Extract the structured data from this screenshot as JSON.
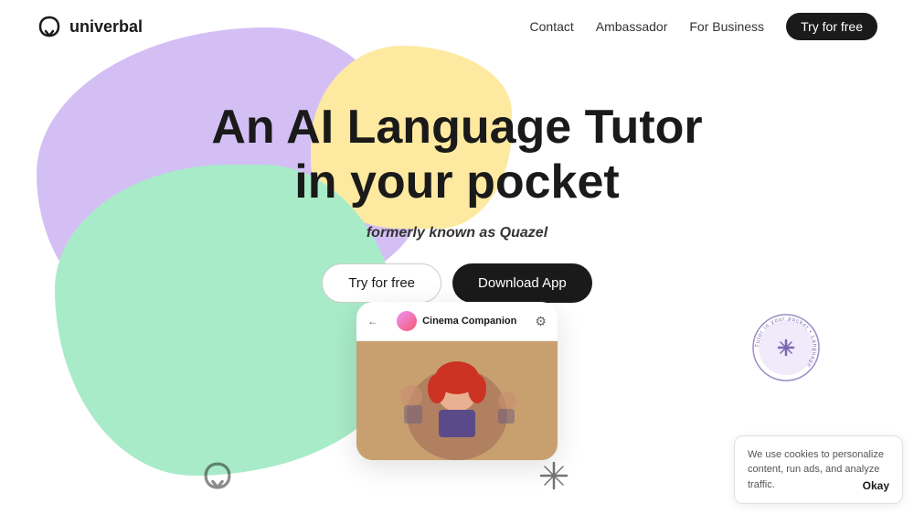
{
  "nav": {
    "logo_text": "univerbal",
    "links": [
      {
        "label": "Contact",
        "id": "contact"
      },
      {
        "label": "Ambassador",
        "id": "ambassador"
      },
      {
        "label": "For Business",
        "id": "for-business"
      }
    ],
    "try_btn": "Try for free"
  },
  "hero": {
    "title_line1": "An AI Language Tutor",
    "title_line2": "in your pocket",
    "subtitle_prefix": "formerly known as ",
    "subtitle_brand": "Quazel",
    "btn_try": "Try for free",
    "btn_download": "Download App"
  },
  "phone": {
    "back_label": "←",
    "chat_title": "Cinema Companion",
    "settings_icon": "⚙"
  },
  "badge": {
    "circle_text": "Tutor in your pocket • Language Tutor in your pocket • Language •",
    "inner_icon": "✦"
  },
  "cookie": {
    "text": "We use cookies to personalize content, run ads, and analyze traffic.",
    "okay_label": "Okay"
  }
}
